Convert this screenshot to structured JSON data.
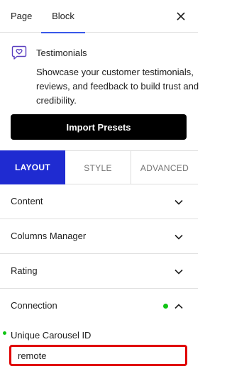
{
  "topbar": {
    "tabs": [
      {
        "label": "Page"
      },
      {
        "label": "Block",
        "active": true
      }
    ]
  },
  "block": {
    "icon": "heart-chat-icon",
    "title": "Testimonials",
    "description": "Showcase your customer testimonials, reviews, and feedback to build trust and credibility."
  },
  "import_button": {
    "label": "Import Presets"
  },
  "mode_tabs": [
    {
      "label": "LAYOUT",
      "active": true
    },
    {
      "label": "STYLE"
    },
    {
      "label": "ADVANCED"
    }
  ],
  "panels": [
    {
      "label": "Content",
      "expanded": false
    },
    {
      "label": "Columns Manager",
      "expanded": false
    },
    {
      "label": "Rating",
      "expanded": false
    },
    {
      "label": "Connection",
      "expanded": true
    }
  ],
  "connection": {
    "field_label": "Unique Carousel ID",
    "field_value": "remote"
  },
  "colors": {
    "accent": "#1f2bd1",
    "tab_underline": "#3858e9",
    "status_green": "#10c414",
    "highlight_red": "#e00000",
    "icon_purple": "#5a3fc0"
  }
}
